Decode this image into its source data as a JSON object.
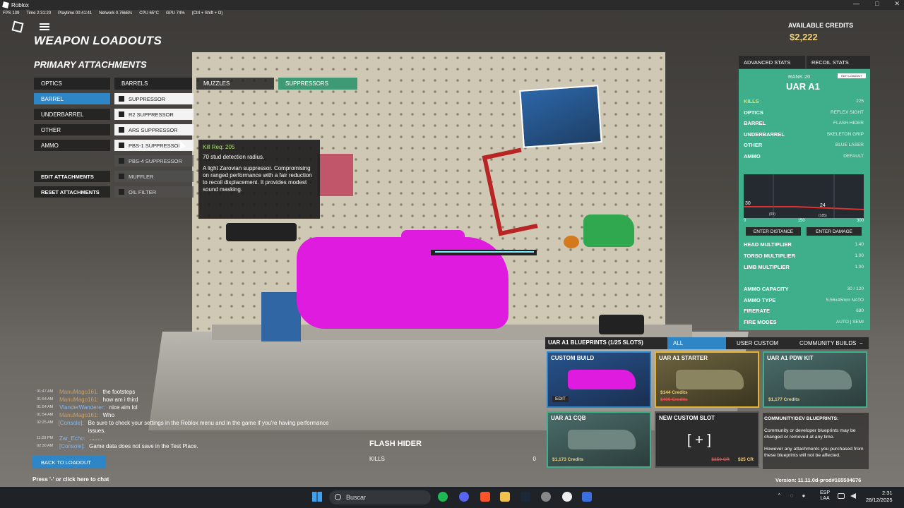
{
  "window": {
    "title": "Roblox"
  },
  "perf": {
    "fps": "FPS 139",
    "time": "Time 2:31:20",
    "playtime": "Playtime 00:41:41",
    "network": "Network 0.76kB/s",
    "cpu": "CPU 65°C",
    "gpu": "GPU 74%",
    "shortcut": "(Ctrl + Shift + O)"
  },
  "header": {
    "title": "WEAPON LOADOUTS",
    "credits_label": "AVAILABLE CREDITS",
    "credits_value": "$2,222"
  },
  "section": {
    "title": "PRIMARY ATTACHMENTS"
  },
  "categories": [
    {
      "label": "OPTICS"
    },
    {
      "label": "BARRELS"
    },
    {
      "label": "MUZZLES"
    },
    {
      "label": "SUPPRESSORS"
    }
  ],
  "slots": [
    {
      "label": "BARREL"
    },
    {
      "label": "UNDERBARREL"
    },
    {
      "label": "OTHER"
    },
    {
      "label": "AMMO"
    }
  ],
  "attachments": [
    {
      "label": "SUPPRESSOR"
    },
    {
      "label": "R2 SUPPRESSOR"
    },
    {
      "label": "ARS SUPPRESSOR"
    },
    {
      "label": "PBS-1 SUPPRESSOR"
    },
    {
      "label": "PBS-4 SUPPRESSOR"
    },
    {
      "label": "MUFFLER"
    },
    {
      "label": "OIL FILTER"
    }
  ],
  "actions": {
    "edit": "EDIT ATTACHMENTS",
    "reset": "RESET ATTACHMENTS",
    "back": "BACK TO LOADOUT"
  },
  "tooltip": {
    "req": "Kill Req: 205",
    "range": "70 stud detection radius.",
    "desc": "A light Zarovian suppressor. Compromising on ranged performance with a fair reduction to recoil displacement. It provides modest sound masking."
  },
  "stats": {
    "tab_advanced": "ADVANCED STATS",
    "tab_recoil": "RECOIL STATS",
    "rank": "RANK 20",
    "rank_badge": "EDIT LOADOUT",
    "weapon": "UAR A1",
    "rows": [
      {
        "label": "KILLS",
        "value": "225"
      },
      {
        "label": "OPTICS",
        "value": "REFLEX SIGHT"
      },
      {
        "label": "BARREL",
        "value": "FLASH HIDER"
      },
      {
        "label": "UNDERBARREL",
        "value": "SKELETON GRIP"
      },
      {
        "label": "OTHER",
        "value": "BLUE LASER"
      },
      {
        "label": "AMMO",
        "value": "DEFAULT"
      }
    ],
    "graph": {
      "y_top": "30",
      "y_bottom": "24",
      "x_a": "(65)",
      "x_b": "(185)",
      "ticks": [
        "0",
        "150",
        "300"
      ]
    },
    "enter_distance": "ENTER DISTANCE",
    "enter_damage": "ENTER DAMAGE",
    "multipliers": [
      {
        "label": "HEAD MULTIPLIER",
        "value": "1.40"
      },
      {
        "label": "TORSO MULTIPLIER",
        "value": "1.00"
      },
      {
        "label": "LIMB MULTIPLIER",
        "value": "1.00"
      }
    ],
    "ammo": [
      {
        "label": "AMMO CAPACITY",
        "value": "30 / 120"
      },
      {
        "label": "AMMO TYPE",
        "value": "5.56x45mm NATO"
      },
      {
        "label": "FIRERATE",
        "value": "680"
      },
      {
        "label": "FIRE MODES",
        "value": "AUTO | SEMI"
      }
    ]
  },
  "blueprints": {
    "title": "UAR A1 BLUEPRINTS (1/25 SLOTS)",
    "tabs": [
      "ALL",
      "USER CUSTOM",
      "COMMUNITY BUILDS"
    ],
    "minimize": "−",
    "cards": [
      {
        "name": "CUSTOM BUILD",
        "edit": "EDIT"
      },
      {
        "name": "UAR A1 STARTER",
        "price": "$144 Credits",
        "strike": "$400 Credits"
      },
      {
        "name": "UAR A1 PDW KIT",
        "price": "$1,177 Credits"
      },
      {
        "name": "UAR A1 CQB",
        "price": "$1,173 Credits"
      },
      {
        "name": "NEW CUSTOM SLOT",
        "plus": "[ + ]",
        "strike": "$250 CR",
        "price": "$25 CR"
      }
    ],
    "info_title": "COMMUNITY/DEV BLUEPRINTS:",
    "info_1": "Community or developer blueprints may be changed or removed at any time.",
    "info_2": "However any attachments you purchased from these blueprints will not be affected."
  },
  "chat": [
    {
      "time": "01:47 AM",
      "user": "ManuMago161:",
      "text": "the footsteps"
    },
    {
      "time": "01:54 AM",
      "user": "ManuMago161:",
      "text": "how am i third"
    },
    {
      "time": "01:54 AM",
      "user": "VlanderWanderer:",
      "text": "nice aim lol"
    },
    {
      "time": "01:54 AM",
      "user": "ManuMago161:",
      "text": "Who"
    },
    {
      "time": "02:25 AM",
      "user": "[Console]:",
      "text": "Be sure to check your settings in the Roblox menu and in the game if you're having performance issues."
    },
    {
      "time": "11:29 PM",
      "user": "Zar_Echo:",
      "text": "........"
    },
    {
      "time": "02:30 AM",
      "user": "[Console]:",
      "text": "Game data does not save in the Test Place."
    }
  ],
  "chat_hint": "Press '-' or click here to chat",
  "detail": {
    "title": "FLASH HIDER",
    "kills_label": "KILLS",
    "kills_value": "0"
  },
  "version": "Version: 11.11.0d-prod#165504676",
  "taskbar": {
    "search": "Buscar",
    "lang_1": "ESP",
    "lang_2": "LAA",
    "time": "2:31",
    "date": "28/12/2025"
  },
  "colors": {
    "accent_blue": "#2f86c7",
    "stats_green": "#3fae8a",
    "credits_gold": "#f2d17a",
    "weapon_magenta": "#e01be0"
  }
}
